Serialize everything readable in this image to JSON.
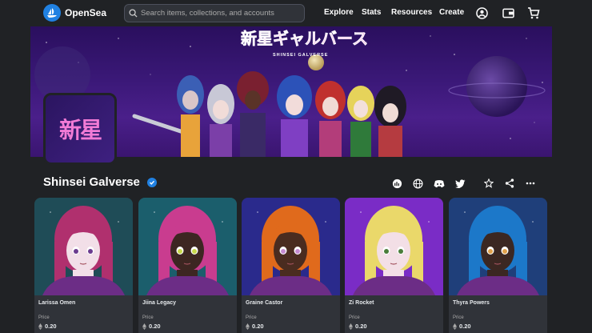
{
  "nav": {
    "brand": "OpenSea",
    "search_placeholder": "Search items, collections, and accounts",
    "links": [
      "Explore",
      "Stats",
      "Resources",
      "Create"
    ]
  },
  "banner": {
    "logo_text": "新星ギャルバース",
    "subtitle": "SHINSEI GALVERSE"
  },
  "avatar_text": "新星",
  "collection": {
    "title": "Shinsei Galverse"
  },
  "cards": [
    {
      "name": "Larissa Omen",
      "price_label": "Price",
      "price": "0.20",
      "hair": "#b0306e",
      "bg": "#1f4c57",
      "skin": "#f2dfe8",
      "eyes": "#6b3b8f"
    },
    {
      "name": "Jiina Legacy",
      "price_label": "Price",
      "price": "0.20",
      "hair": "#c93c8f",
      "bg": "#1b5e6c",
      "skin": "#3d2622",
      "eyes": "#c7d94a"
    },
    {
      "name": "Graine Castor",
      "price_label": "Price",
      "price": "0.20",
      "hair": "#e06a1c",
      "bg": "#2a2a8c",
      "skin": "#4a2c20",
      "eyes": "#c58bd2"
    },
    {
      "name": "Zi Rocket",
      "price_label": "Price",
      "price": "0.20",
      "hair": "#ead86a",
      "bg": "#7a2cc6",
      "skin": "#f3dfe6",
      "eyes": "#4a7d3a"
    },
    {
      "name": "Thyra Powers",
      "price_label": "Price",
      "price": "0.20",
      "hair": "#1c78c9",
      "bg": "#1f3f7a",
      "skin": "#3b2722",
      "eyes": "#e0a04a"
    }
  ],
  "colors": {
    "accent": "#2081e2",
    "bg": "#202225",
    "card": "#303339"
  }
}
